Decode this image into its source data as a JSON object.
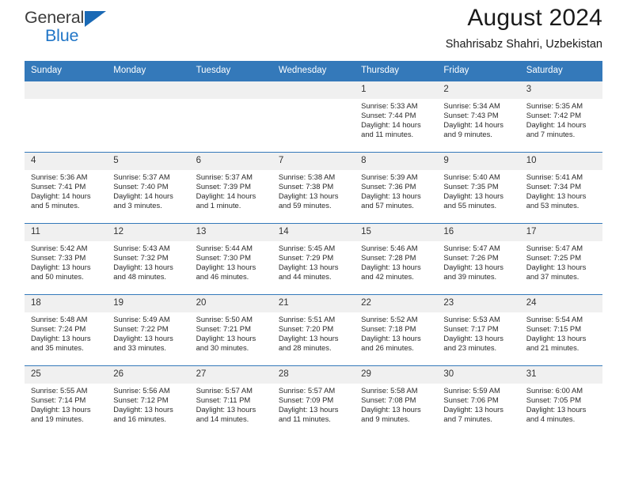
{
  "brand": {
    "line1": "General",
    "line2": "Blue",
    "triangle_color": "#1a69b5",
    "text_color": "#3c3c3c",
    "accent_color": "#2176c7"
  },
  "header": {
    "title": "August 2024",
    "subtitle": "Shahrisabz Shahri, Uzbekistan"
  },
  "theme": {
    "header_row_bg": "#3479ba",
    "daynum_bg": "#f0f0f0",
    "row_border": "#3479ba",
    "text": "#2a2a2a"
  },
  "weekday_headers": [
    "Sunday",
    "Monday",
    "Tuesday",
    "Wednesday",
    "Thursday",
    "Friday",
    "Saturday"
  ],
  "labels": {
    "sunrise": "Sunrise:",
    "sunset": "Sunset:",
    "daylight": "Daylight:"
  },
  "weeks": [
    [
      {
        "day": "",
        "empty": true
      },
      {
        "day": "",
        "empty": true
      },
      {
        "day": "",
        "empty": true
      },
      {
        "day": "",
        "empty": true
      },
      {
        "day": "1",
        "sunrise": "Sunrise: 5:33 AM",
        "sunset": "Sunset: 7:44 PM",
        "daylight": "Daylight: 14 hours and 11 minutes."
      },
      {
        "day": "2",
        "sunrise": "Sunrise: 5:34 AM",
        "sunset": "Sunset: 7:43 PM",
        "daylight": "Daylight: 14 hours and 9 minutes."
      },
      {
        "day": "3",
        "sunrise": "Sunrise: 5:35 AM",
        "sunset": "Sunset: 7:42 PM",
        "daylight": "Daylight: 14 hours and 7 minutes."
      }
    ],
    [
      {
        "day": "4",
        "sunrise": "Sunrise: 5:36 AM",
        "sunset": "Sunset: 7:41 PM",
        "daylight": "Daylight: 14 hours and 5 minutes."
      },
      {
        "day": "5",
        "sunrise": "Sunrise: 5:37 AM",
        "sunset": "Sunset: 7:40 PM",
        "daylight": "Daylight: 14 hours and 3 minutes."
      },
      {
        "day": "6",
        "sunrise": "Sunrise: 5:37 AM",
        "sunset": "Sunset: 7:39 PM",
        "daylight": "Daylight: 14 hours and 1 minute."
      },
      {
        "day": "7",
        "sunrise": "Sunrise: 5:38 AM",
        "sunset": "Sunset: 7:38 PM",
        "daylight": "Daylight: 13 hours and 59 minutes."
      },
      {
        "day": "8",
        "sunrise": "Sunrise: 5:39 AM",
        "sunset": "Sunset: 7:36 PM",
        "daylight": "Daylight: 13 hours and 57 minutes."
      },
      {
        "day": "9",
        "sunrise": "Sunrise: 5:40 AM",
        "sunset": "Sunset: 7:35 PM",
        "daylight": "Daylight: 13 hours and 55 minutes."
      },
      {
        "day": "10",
        "sunrise": "Sunrise: 5:41 AM",
        "sunset": "Sunset: 7:34 PM",
        "daylight": "Daylight: 13 hours and 53 minutes."
      }
    ],
    [
      {
        "day": "11",
        "sunrise": "Sunrise: 5:42 AM",
        "sunset": "Sunset: 7:33 PM",
        "daylight": "Daylight: 13 hours and 50 minutes."
      },
      {
        "day": "12",
        "sunrise": "Sunrise: 5:43 AM",
        "sunset": "Sunset: 7:32 PM",
        "daylight": "Daylight: 13 hours and 48 minutes."
      },
      {
        "day": "13",
        "sunrise": "Sunrise: 5:44 AM",
        "sunset": "Sunset: 7:30 PM",
        "daylight": "Daylight: 13 hours and 46 minutes."
      },
      {
        "day": "14",
        "sunrise": "Sunrise: 5:45 AM",
        "sunset": "Sunset: 7:29 PM",
        "daylight": "Daylight: 13 hours and 44 minutes."
      },
      {
        "day": "15",
        "sunrise": "Sunrise: 5:46 AM",
        "sunset": "Sunset: 7:28 PM",
        "daylight": "Daylight: 13 hours and 42 minutes."
      },
      {
        "day": "16",
        "sunrise": "Sunrise: 5:47 AM",
        "sunset": "Sunset: 7:26 PM",
        "daylight": "Daylight: 13 hours and 39 minutes."
      },
      {
        "day": "17",
        "sunrise": "Sunrise: 5:47 AM",
        "sunset": "Sunset: 7:25 PM",
        "daylight": "Daylight: 13 hours and 37 minutes."
      }
    ],
    [
      {
        "day": "18",
        "sunrise": "Sunrise: 5:48 AM",
        "sunset": "Sunset: 7:24 PM",
        "daylight": "Daylight: 13 hours and 35 minutes."
      },
      {
        "day": "19",
        "sunrise": "Sunrise: 5:49 AM",
        "sunset": "Sunset: 7:22 PM",
        "daylight": "Daylight: 13 hours and 33 minutes."
      },
      {
        "day": "20",
        "sunrise": "Sunrise: 5:50 AM",
        "sunset": "Sunset: 7:21 PM",
        "daylight": "Daylight: 13 hours and 30 minutes."
      },
      {
        "day": "21",
        "sunrise": "Sunrise: 5:51 AM",
        "sunset": "Sunset: 7:20 PM",
        "daylight": "Daylight: 13 hours and 28 minutes."
      },
      {
        "day": "22",
        "sunrise": "Sunrise: 5:52 AM",
        "sunset": "Sunset: 7:18 PM",
        "daylight": "Daylight: 13 hours and 26 minutes."
      },
      {
        "day": "23",
        "sunrise": "Sunrise: 5:53 AM",
        "sunset": "Sunset: 7:17 PM",
        "daylight": "Daylight: 13 hours and 23 minutes."
      },
      {
        "day": "24",
        "sunrise": "Sunrise: 5:54 AM",
        "sunset": "Sunset: 7:15 PM",
        "daylight": "Daylight: 13 hours and 21 minutes."
      }
    ],
    [
      {
        "day": "25",
        "sunrise": "Sunrise: 5:55 AM",
        "sunset": "Sunset: 7:14 PM",
        "daylight": "Daylight: 13 hours and 19 minutes."
      },
      {
        "day": "26",
        "sunrise": "Sunrise: 5:56 AM",
        "sunset": "Sunset: 7:12 PM",
        "daylight": "Daylight: 13 hours and 16 minutes."
      },
      {
        "day": "27",
        "sunrise": "Sunrise: 5:57 AM",
        "sunset": "Sunset: 7:11 PM",
        "daylight": "Daylight: 13 hours and 14 minutes."
      },
      {
        "day": "28",
        "sunrise": "Sunrise: 5:57 AM",
        "sunset": "Sunset: 7:09 PM",
        "daylight": "Daylight: 13 hours and 11 minutes."
      },
      {
        "day": "29",
        "sunrise": "Sunrise: 5:58 AM",
        "sunset": "Sunset: 7:08 PM",
        "daylight": "Daylight: 13 hours and 9 minutes."
      },
      {
        "day": "30",
        "sunrise": "Sunrise: 5:59 AM",
        "sunset": "Sunset: 7:06 PM",
        "daylight": "Daylight: 13 hours and 7 minutes."
      },
      {
        "day": "31",
        "sunrise": "Sunrise: 6:00 AM",
        "sunset": "Sunset: 7:05 PM",
        "daylight": "Daylight: 13 hours and 4 minutes."
      }
    ]
  ]
}
